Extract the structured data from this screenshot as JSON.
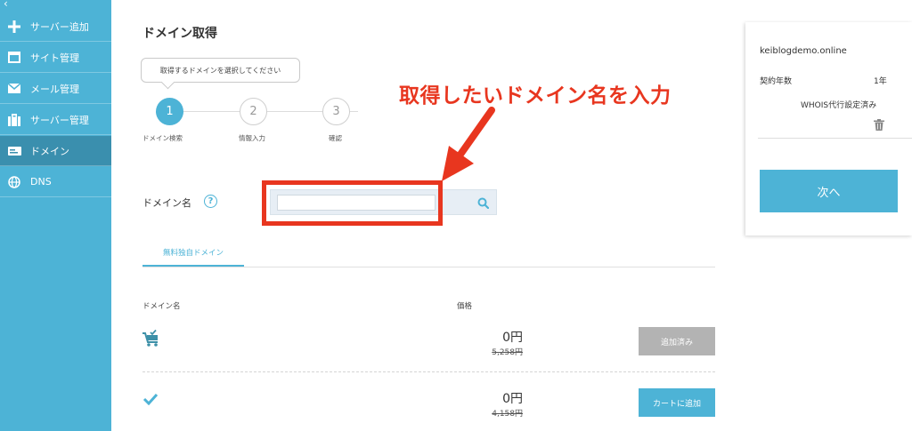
{
  "sidebar": {
    "back_icon": "‹",
    "items": [
      {
        "label": "サーバー追加",
        "icon": "plus-icon"
      },
      {
        "label": "サイト管理",
        "icon": "window-icon"
      },
      {
        "label": "メール管理",
        "icon": "mail-icon"
      },
      {
        "label": "サーバー管理",
        "icon": "server-icon"
      },
      {
        "label": "ドメイン",
        "icon": "domain-icon",
        "active": true
      },
      {
        "label": "DNS",
        "icon": "globe-icon"
      }
    ]
  },
  "main": {
    "title": "ドメイン取得",
    "tooltip": "取得するドメインを選択してください",
    "steps": [
      {
        "number": "1",
        "label": "ドメイン検索"
      },
      {
        "number": "2",
        "label": "情報入力"
      },
      {
        "number": "3",
        "label": "確認"
      }
    ],
    "callout": "取得したいドメイン名を入力",
    "search": {
      "label": "ドメイン名",
      "help_icon": "?",
      "value": "",
      "placeholder": ""
    },
    "tab_label": "無料独自ドメイン",
    "table": {
      "col_domain": "ドメイン名",
      "col_price": "価格",
      "rows": [
        {
          "icon": "cart-check-icon",
          "price": "0円",
          "old_price": "5,258円",
          "button": "追加済み"
        },
        {
          "icon": "check-icon",
          "price": "0円",
          "old_price": "4,158円",
          "button": "カートに追加"
        }
      ]
    }
  },
  "cart_panel": {
    "domain": "keiblogdemo.online",
    "term_label": "契約年数",
    "term_value": "1年",
    "whois": "WHOIS代行設定済み",
    "next_button": "次へ"
  },
  "colors": {
    "accent": "#4db3d6",
    "sidebar_active": "#3a8fae",
    "callout": "#e8361f"
  }
}
